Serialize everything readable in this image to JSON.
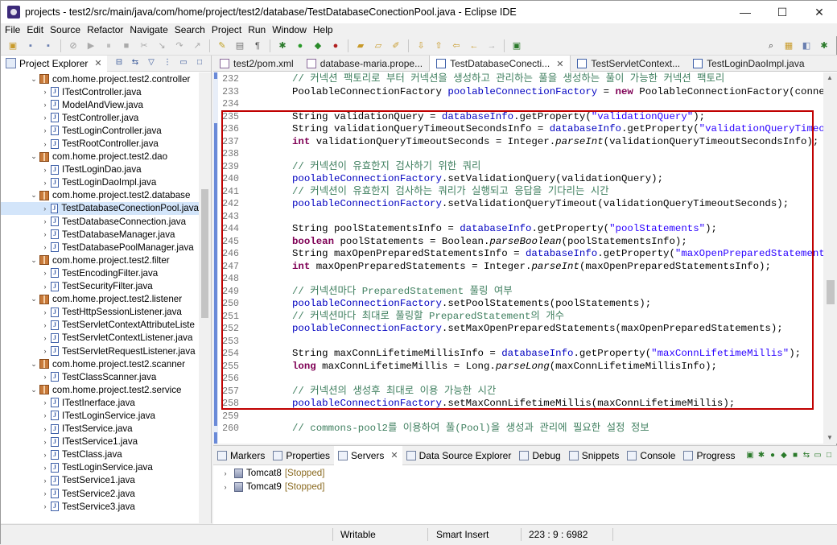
{
  "window": {
    "title": "projects - test2/src/main/java/com/home/project/test2/database/TestDatabaseConectionPool.java - Eclipse IDE",
    "minimize": "—",
    "maximize": "☐",
    "close": "✕"
  },
  "menu": [
    "File",
    "Edit",
    "Source",
    "Refactor",
    "Navigate",
    "Search",
    "Project",
    "Run",
    "Window",
    "Help"
  ],
  "explorer": {
    "tab_label": "Project Explorer",
    "close": "✕",
    "items": [
      {
        "type": "pkg",
        "label": "com.home.project.test2.controller"
      },
      {
        "type": "file",
        "label": "ITestController.java"
      },
      {
        "type": "file",
        "label": "ModelAndView.java"
      },
      {
        "type": "file",
        "label": "TestController.java"
      },
      {
        "type": "file",
        "label": "TestLoginController.java"
      },
      {
        "type": "file",
        "label": "TestRootController.java"
      },
      {
        "type": "pkg",
        "label": "com.home.project.test2.dao"
      },
      {
        "type": "file",
        "label": "ITestLoginDao.java"
      },
      {
        "type": "file",
        "label": "TestLoginDaoImpl.java"
      },
      {
        "type": "pkg",
        "label": "com.home.project.test2.database"
      },
      {
        "type": "file",
        "label": "TestDatabaseConectionPool.java",
        "selected": true
      },
      {
        "type": "file",
        "label": "TestDatabaseConnection.java"
      },
      {
        "type": "file",
        "label": "TestDatabaseManager.java"
      },
      {
        "type": "file",
        "label": "TestDatabasePoolManager.java"
      },
      {
        "type": "pkg",
        "label": "com.home.project.test2.filter"
      },
      {
        "type": "file",
        "label": "TestEncodingFilter.java"
      },
      {
        "type": "file",
        "label": "TestSecurityFilter.java"
      },
      {
        "type": "pkg",
        "label": "com.home.project.test2.listener"
      },
      {
        "type": "file",
        "label": "TestHttpSessionListener.java"
      },
      {
        "type": "file",
        "label": "TestServletContextAttributeListe"
      },
      {
        "type": "file",
        "label": "TestServletContextListener.java"
      },
      {
        "type": "file",
        "label": "TestServletRequestListener.java"
      },
      {
        "type": "pkg",
        "label": "com.home.project.test2.scanner"
      },
      {
        "type": "file",
        "label": "TestClassScanner.java"
      },
      {
        "type": "pkg",
        "label": "com.home.project.test2.service"
      },
      {
        "type": "file",
        "label": "ITestInerface.java"
      },
      {
        "type": "file",
        "label": "ITestLoginService.java"
      },
      {
        "type": "file",
        "label": "ITestService.java"
      },
      {
        "type": "file",
        "label": "ITestService1.java"
      },
      {
        "type": "file",
        "label": "TestClass.java"
      },
      {
        "type": "file",
        "label": "TestLoginService.java"
      },
      {
        "type": "file",
        "label": "TestService1.java"
      },
      {
        "type": "file",
        "label": "TestService2.java"
      },
      {
        "type": "file",
        "label": "TestService3.java"
      }
    ]
  },
  "editor": {
    "tabs": [
      {
        "label": "test2/pom.xml",
        "icon": "xml"
      },
      {
        "label": "database-maria.prope...",
        "icon": "props"
      },
      {
        "label": "TestDatabaseConecti...",
        "icon": "java",
        "active": true,
        "close": "✕"
      },
      {
        "label": "TestServletContext...",
        "icon": "java"
      },
      {
        "label": "TestLoginDaoImpl.java",
        "icon": "java"
      }
    ],
    "lines": [
      {
        "n": "232",
        "parts": [
          [
            "c",
            "// 커넥션 팩토리로 부터 커넥션을 생성하고 관리하는 풀을 생성하는 풀이 가능한 커넥션 팩토리"
          ]
        ]
      },
      {
        "n": "233",
        "parts": [
          [
            "t",
            "PoolableConnectionFactory "
          ],
          [
            "f",
            "poolableConnectionFactory"
          ],
          [
            "t",
            " = "
          ],
          [
            "k",
            "new"
          ],
          [
            "t",
            " PoolableConnectionFactory(connectionFac"
          ]
        ]
      },
      {
        "n": "234",
        "parts": []
      },
      {
        "n": "235",
        "parts": [
          [
            "t",
            "String validationQuery = "
          ],
          [
            "f",
            "databaseInfo"
          ],
          [
            "t",
            ".getProperty("
          ],
          [
            "s",
            "\"validationQuery\""
          ],
          [
            "t",
            ");"
          ]
        ]
      },
      {
        "n": "236",
        "parts": [
          [
            "t",
            "String validationQueryTimeoutSecondsInfo = "
          ],
          [
            "f",
            "databaseInfo"
          ],
          [
            "t",
            ".getProperty("
          ],
          [
            "s",
            "\"validationQueryTimeoutSeconds\""
          ]
        ]
      },
      {
        "n": "237",
        "parts": [
          [
            "k",
            "int"
          ],
          [
            "t",
            " validationQueryTimeoutSeconds = Integer."
          ],
          [
            "i",
            "parseInt"
          ],
          [
            "t",
            "(validationQueryTimeoutSecondsInfo);"
          ]
        ]
      },
      {
        "n": "238",
        "parts": []
      },
      {
        "n": "239",
        "parts": [
          [
            "c",
            "// 커넥션이 유효한지 검사하기 위한 쿼리"
          ]
        ]
      },
      {
        "n": "240",
        "parts": [
          [
            "f",
            "poolableConnectionFactory"
          ],
          [
            "t",
            ".setValidationQuery(validationQuery);"
          ]
        ]
      },
      {
        "n": "241",
        "parts": [
          [
            "c",
            "// 커넥션이 유효한지 검사하는 쿼리가 실행되고 응답을 기다리는 시간"
          ]
        ]
      },
      {
        "n": "242",
        "parts": [
          [
            "f",
            "poolableConnectionFactory"
          ],
          [
            "t",
            ".setValidationQueryTimeout(validationQueryTimeoutSeconds);"
          ]
        ]
      },
      {
        "n": "243",
        "parts": []
      },
      {
        "n": "244",
        "parts": [
          [
            "t",
            "String poolStatementsInfo = "
          ],
          [
            "f",
            "databaseInfo"
          ],
          [
            "t",
            ".getProperty("
          ],
          [
            "s",
            "\"poolStatements\""
          ],
          [
            "t",
            ");"
          ]
        ]
      },
      {
        "n": "245",
        "parts": [
          [
            "k",
            "boolean"
          ],
          [
            "t",
            " poolStatements = Boolean."
          ],
          [
            "i",
            "parseBoolean"
          ],
          [
            "t",
            "(poolStatementsInfo);"
          ]
        ]
      },
      {
        "n": "246",
        "parts": [
          [
            "t",
            "String maxOpenPreparedStatementsInfo = "
          ],
          [
            "f",
            "databaseInfo"
          ],
          [
            "t",
            ".getProperty("
          ],
          [
            "s",
            "\"maxOpenPreparedStatements\""
          ],
          [
            "t",
            ");"
          ]
        ]
      },
      {
        "n": "247",
        "parts": [
          [
            "k",
            "int"
          ],
          [
            "t",
            " maxOpenPreparedStatements = Integer."
          ],
          [
            "i",
            "parseInt"
          ],
          [
            "t",
            "(maxOpenPreparedStatementsInfo);"
          ]
        ]
      },
      {
        "n": "248",
        "parts": []
      },
      {
        "n": "249",
        "parts": [
          [
            "c",
            "// 커넥션마다 PreparedStatement 풀링 여부"
          ]
        ]
      },
      {
        "n": "250",
        "parts": [
          [
            "f",
            "poolableConnectionFactory"
          ],
          [
            "t",
            ".setPoolStatements(poolStatements);"
          ]
        ]
      },
      {
        "n": "251",
        "parts": [
          [
            "c",
            "// 커넥션마다 최대로 풀링할 PreparedStatement의 개수"
          ]
        ]
      },
      {
        "n": "252",
        "parts": [
          [
            "f",
            "poolableConnectionFactory"
          ],
          [
            "t",
            ".setMaxOpenPreparedStatements(maxOpenPreparedStatements);"
          ]
        ]
      },
      {
        "n": "253",
        "parts": []
      },
      {
        "n": "254",
        "parts": [
          [
            "t",
            "String maxConnLifetimeMillisInfo = "
          ],
          [
            "f",
            "databaseInfo"
          ],
          [
            "t",
            ".getProperty("
          ],
          [
            "s",
            "\"maxConnLifetimeMillis\""
          ],
          [
            "t",
            ");"
          ]
        ]
      },
      {
        "n": "255",
        "parts": [
          [
            "k",
            "long"
          ],
          [
            "t",
            " maxConnLifetimeMillis = Long."
          ],
          [
            "i",
            "parseLong"
          ],
          [
            "t",
            "(maxConnLifetimeMillisInfo);"
          ]
        ]
      },
      {
        "n": "256",
        "parts": []
      },
      {
        "n": "257",
        "parts": [
          [
            "c",
            "// 커넥션의 생성후 최대로 이용 가능한 시간"
          ]
        ]
      },
      {
        "n": "258",
        "parts": [
          [
            "f",
            "poolableConnectionFactory"
          ],
          [
            "t",
            ".setMaxConnLifetimeMillis(maxConnLifetimeMillis);"
          ]
        ]
      },
      {
        "n": "259",
        "parts": []
      },
      {
        "n": "260",
        "parts": [
          [
            "c",
            "// commons-pool2를 이용하여 풀(Pool)을 생성과 관리에 필요한 설정 정보"
          ]
        ]
      }
    ]
  },
  "bottom": {
    "tabs": [
      {
        "label": "Markers"
      },
      {
        "label": "Properties"
      },
      {
        "label": "Servers",
        "active": true,
        "close": "✕"
      },
      {
        "label": "Data Source Explorer"
      },
      {
        "label": "Debug"
      },
      {
        "label": "Snippets"
      },
      {
        "label": "Console"
      },
      {
        "label": "Progress"
      }
    ],
    "servers": [
      {
        "name": "Tomcat8",
        "state": "[Stopped]"
      },
      {
        "name": "Tomcat9",
        "state": "[Stopped]"
      }
    ]
  },
  "status": {
    "mode": "Writable",
    "insert": "Smart Insert",
    "position": "223 : 9 : 6982"
  }
}
